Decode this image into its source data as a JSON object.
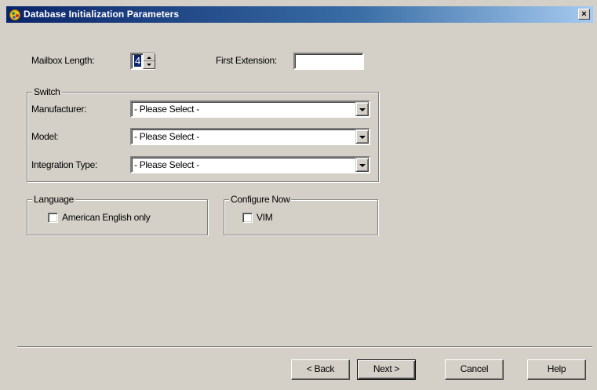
{
  "window": {
    "title": "Database Initialization Parameters",
    "close_glyph": "×",
    "icon": "app-icon"
  },
  "mailbox": {
    "label": "Mailbox Length:",
    "value": "4"
  },
  "first_extension": {
    "label": "First Extension:",
    "value": ""
  },
  "switch_group": {
    "label": "Switch",
    "manufacturer": {
      "label": "Manufacturer:",
      "value": "- Please Select -"
    },
    "model": {
      "label": "Model:",
      "value": "- Please Select -"
    },
    "integration_type": {
      "label": "Integration Type:",
      "value": "- Please Select -"
    }
  },
  "language_group": {
    "label": "Language",
    "checkbox_label": "American English only",
    "checked": false
  },
  "configure_group": {
    "label": "Configure Now",
    "checkbox_label": "VIM",
    "checked": false
  },
  "buttons": {
    "back": "< Back",
    "next": "Next >",
    "cancel": "Cancel",
    "help": "Help"
  }
}
